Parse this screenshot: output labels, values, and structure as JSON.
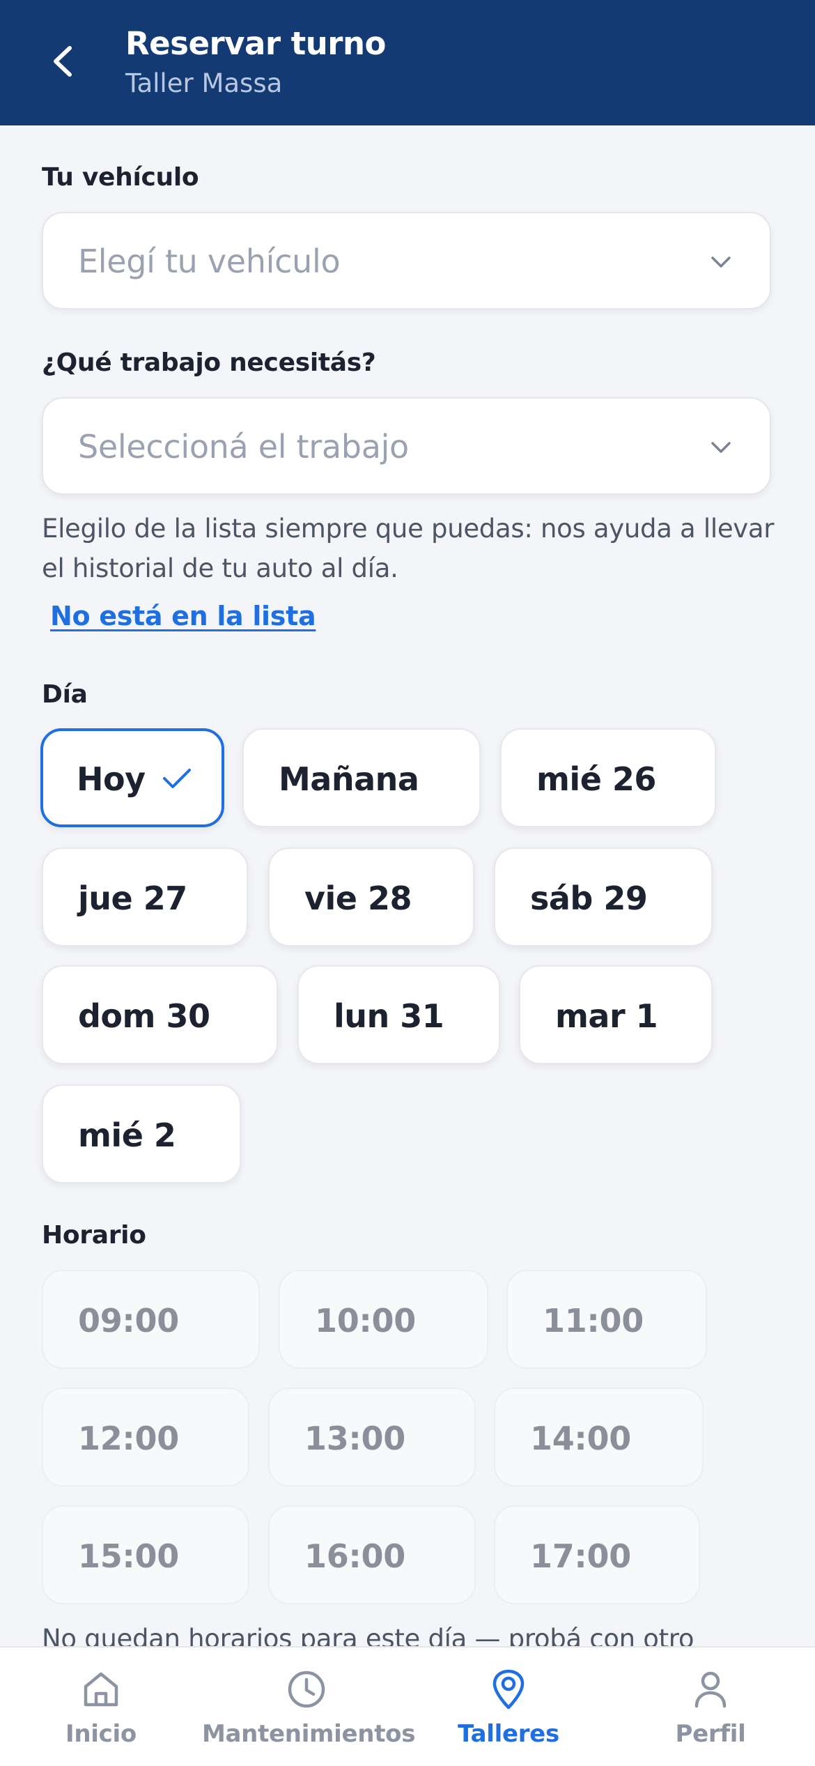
{
  "header": {
    "title": "Reservar turno",
    "subtitle": "Taller Massa"
  },
  "vehicle": {
    "label": "Tu vehículo",
    "placeholder": "Elegí tu vehículo"
  },
  "work": {
    "label": "¿Qué trabajo necesitás?",
    "placeholder": "Seleccioná el trabajo",
    "help": "Elegilo de la lista siempre que puedas: nos ayuda a llevar el historial de tu auto al día.",
    "not_listed_link": "No está en la lista"
  },
  "day": {
    "label": "Día",
    "selected": "Hoy",
    "options": [
      "Hoy",
      "Mañana",
      "mié 26",
      "jue 27",
      "vie 28",
      "sáb 29",
      "dom 30",
      "lun 31",
      "mar 1",
      "mié 2"
    ]
  },
  "time": {
    "label": "Horario",
    "options": [
      "09:00",
      "10:00",
      "11:00",
      "12:00",
      "13:00",
      "14:00",
      "15:00",
      "16:00",
      "17:00"
    ],
    "note": "No quedan horarios para este día — probá con otro"
  },
  "nav": {
    "items": [
      {
        "label": "Inicio",
        "icon": "home-icon"
      },
      {
        "label": "Mantenimientos",
        "icon": "clock-icon"
      },
      {
        "label": "Talleres",
        "icon": "location-pin-icon",
        "active": true
      },
      {
        "label": "Perfil",
        "icon": "user-icon"
      }
    ]
  },
  "colors": {
    "header_bg": "#143a73",
    "accent": "#1f6fe0",
    "background": "#f4f5f8"
  }
}
